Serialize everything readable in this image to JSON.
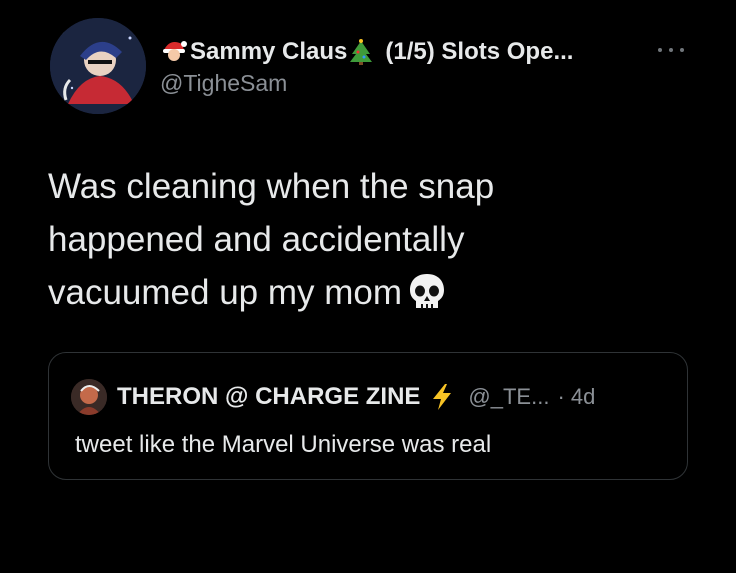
{
  "author": {
    "display_name": "Sammy Claus",
    "name_suffix": "(1/5) Slots Ope...",
    "handle": "@TigheSam",
    "avatar": "avatar-image",
    "name_emoji_before": "santa-emoji",
    "name_emoji_after": "christmas-tree-emoji"
  },
  "tweet": {
    "text": "Was cleaning when the snap\nhappened and accidentally\nvacuumed up my mom",
    "trailing_emoji": "skull-emoji"
  },
  "quoted_tweet": {
    "author_name": "THERON @ CHARGE ZINE",
    "author_emoji": "lightning-emoji",
    "handle": "@_TE...",
    "time": "· 4d",
    "text": "tweet like the Marvel Universe was real"
  },
  "colors": {
    "background": "#000000",
    "text": "#e7e9ea",
    "secondary": "#8b9096",
    "border": "#2f3336",
    "bolt": "#f7c325"
  }
}
